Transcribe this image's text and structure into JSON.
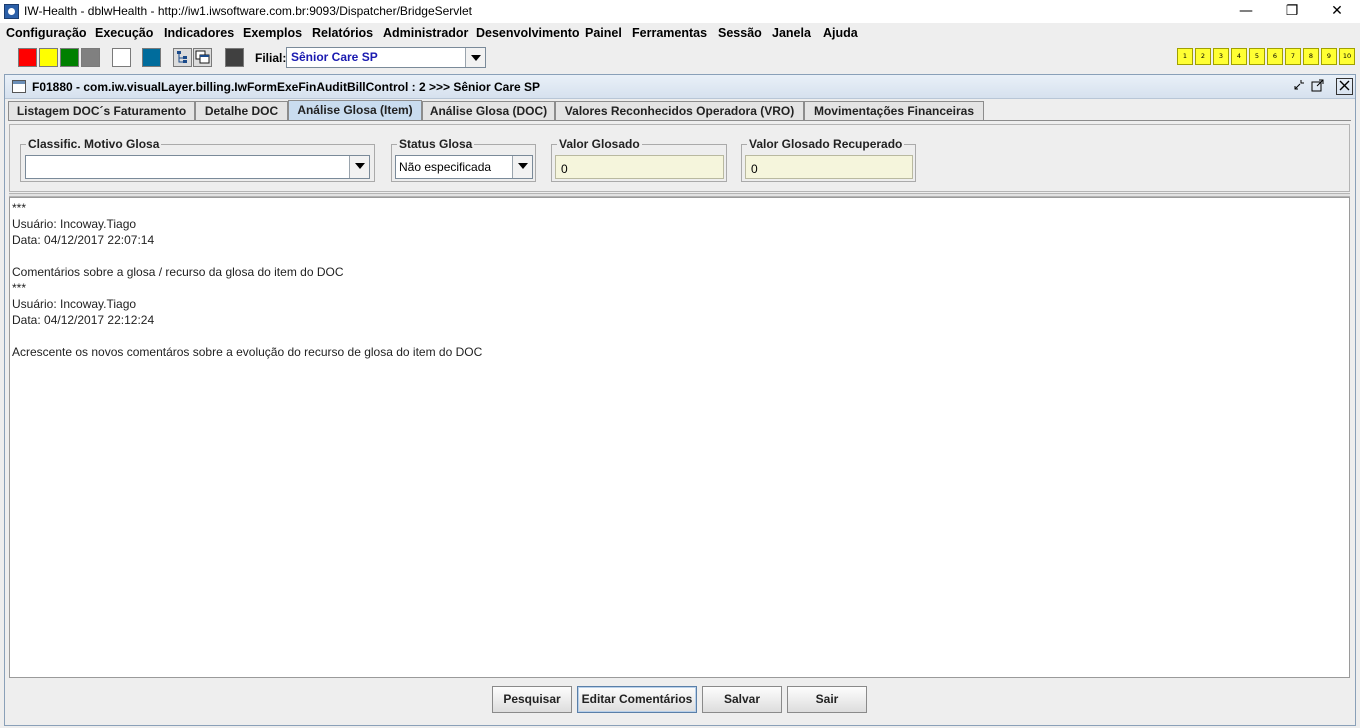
{
  "window": {
    "title": "IW-Health - dblwHealth - http://iw1.iwsoftware.com.br:9093/Dispatcher/BridgeServlet",
    "minimize": "—",
    "restore": "❐",
    "close": "✕"
  },
  "menu": [
    "Configuração",
    "Execução",
    "Indicadores",
    "Exemplos",
    "Relatórios",
    "Administrador",
    "Desenvolvimento",
    "Painel",
    "Ferramentas",
    "Sessão",
    "Janela",
    "Ajuda"
  ],
  "toolbar": {
    "swatches": [
      "#ff0000",
      "#ffff00",
      "#008000",
      "#808080",
      "#ffffff",
      "#006c9c",
      "#404040"
    ],
    "filial_label": "Filial:",
    "filial_value": "Sênior Care SP",
    "numbers": [
      "1",
      "2",
      "3",
      "4",
      "5",
      "6",
      "7",
      "8",
      "9",
      "10"
    ]
  },
  "frame": {
    "title": "F01880 - com.iw.visualLayer.billing.IwFormExeFinAuditBillControl : 2 >>> Sênior Care SP"
  },
  "tabs": [
    {
      "label": "Listagem DOC´s Faturamento",
      "active": false
    },
    {
      "label": "Detalhe DOC",
      "active": false
    },
    {
      "label": "Análise Glosa (Item)",
      "active": true
    },
    {
      "label": "Análise Glosa (DOC)",
      "active": false
    },
    {
      "label": "Valores Reconhecidos Operadora (VRO)",
      "active": false
    },
    {
      "label": "Movimentações Financeiras",
      "active": false
    }
  ],
  "filters": {
    "motivo": {
      "label": "Classific. Motivo Glosa",
      "value": ""
    },
    "status": {
      "label": "Status Glosa",
      "value": "Não especificada"
    },
    "valor_glosado": {
      "label": "Valor Glosado",
      "value": "0"
    },
    "valor_recuperado": {
      "label": "Valor Glosado Recuperado",
      "value": "0"
    }
  },
  "comments": "***\nUsuário: Incoway.Tiago\nData: 04/12/2017 22:07:14\n\nComentários sobre a glosa / recurso da glosa do item do DOC\n***\nUsuário: Incoway.Tiago\nData: 04/12/2017 22:12:24\n\nAcrescente os novos comentáros sobre a evolução do recurso de glosa do item do DOC",
  "buttons": {
    "pesquisar": "Pesquisar",
    "editar": "Editar Comentários",
    "salvar": "Salvar",
    "sair": "Sair"
  }
}
